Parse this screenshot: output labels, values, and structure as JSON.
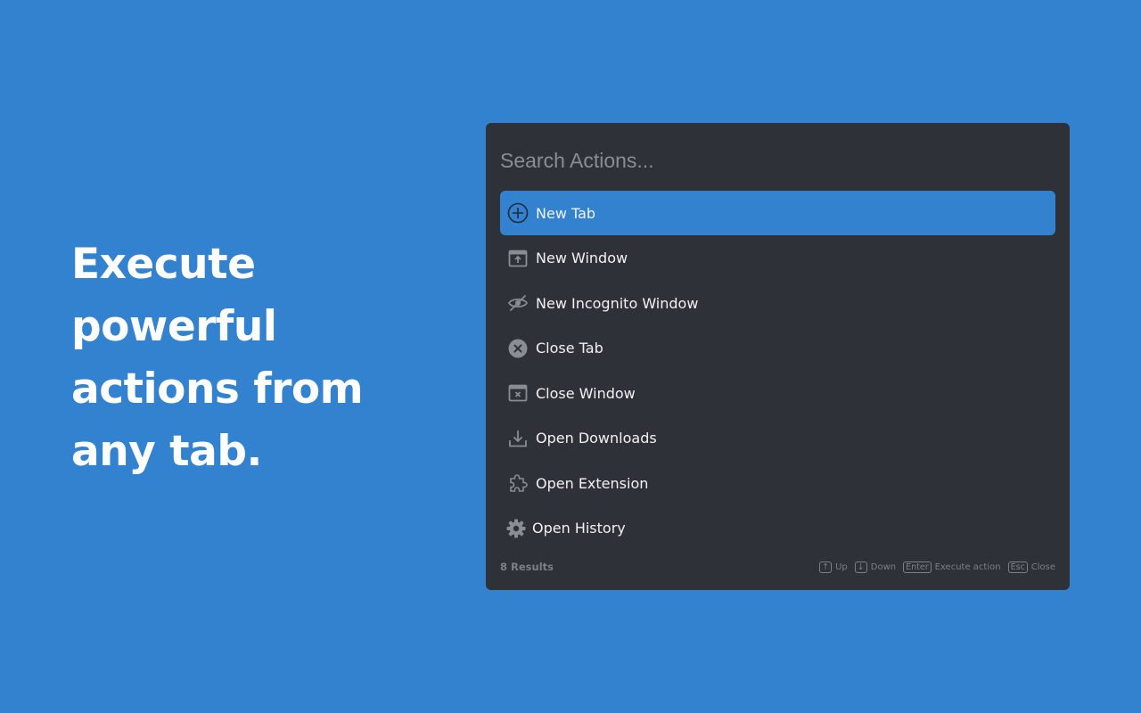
{
  "headline": {
    "lines": [
      "Execute",
      "powerful",
      "actions from",
      "any tab."
    ]
  },
  "palette": {
    "search": {
      "placeholder": "Search Actions...",
      "value": ""
    },
    "items": [
      {
        "label": "New Tab",
        "icon": "plus-circle-icon",
        "active": true
      },
      {
        "label": "New Window",
        "icon": "new-window-icon",
        "active": false
      },
      {
        "label": "New Incognito Window",
        "icon": "eye-off-icon",
        "active": false
      },
      {
        "label": "Close Tab",
        "icon": "close-circle-icon",
        "active": false
      },
      {
        "label": "Close Window",
        "icon": "close-window-icon",
        "active": false
      },
      {
        "label": "Open Downloads",
        "icon": "download-icon",
        "active": false
      },
      {
        "label": "Open Extension",
        "icon": "puzzle-icon",
        "active": false
      },
      {
        "label": "Open History",
        "icon": "gear-icon",
        "active": false
      }
    ],
    "footer": {
      "results": "8 Results",
      "hints": [
        {
          "key": "↑",
          "label": "Up"
        },
        {
          "key": "↓",
          "label": "Down"
        },
        {
          "key": "Enter",
          "label": "Execute action"
        },
        {
          "key": "Esc",
          "label": "Close"
        }
      ]
    }
  },
  "colors": {
    "background": "#3282CF",
    "panel": "#2E3138",
    "highlight": "#3282CF",
    "text": "#F2F2F2",
    "muted": "#7C7F86"
  }
}
